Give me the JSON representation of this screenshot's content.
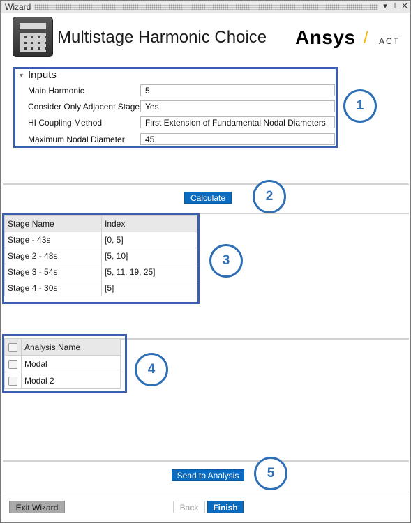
{
  "window": {
    "title": "Wizard",
    "controls": [
      "▾",
      "⊥",
      "✕"
    ]
  },
  "header": {
    "title": "Multistage Harmonic Choice",
    "brand": "Ansys",
    "brand_slash": "/",
    "brand_suffix": "ACT"
  },
  "inputs": {
    "title": "Inputs",
    "fields": [
      {
        "label": "Main Harmonic",
        "value": "5"
      },
      {
        "label": "Consider Only Adjacent Stages",
        "value": "Yes"
      },
      {
        "label": "HI Coupling Method",
        "value": "First Extension of Fundamental Nodal Diameters"
      },
      {
        "label": "Maximum Nodal Diameter",
        "value": "45"
      }
    ]
  },
  "calculate_label": "Calculate",
  "stages": {
    "headers": [
      "Stage Name",
      "Index"
    ],
    "rows": [
      [
        "Stage - 43s",
        "[0, 5]"
      ],
      [
        "Stage 2 - 48s",
        "[5, 10]"
      ],
      [
        "Stage 3 - 54s",
        "[5, 11, 19, 25]"
      ],
      [
        "Stage 4 - 30s",
        "[5]"
      ]
    ]
  },
  "analysis": {
    "header": "Analysis Name",
    "rows": [
      "Modal",
      "Modal 2"
    ]
  },
  "send_label": "Send to Analysis",
  "footer": {
    "exit_label": "Exit Wizard",
    "back_label": "Back",
    "finish_label": "Finish"
  },
  "callouts": [
    "1",
    "2",
    "3",
    "4",
    "5"
  ],
  "colors": {
    "accent_blue": "#0b6bbf",
    "callout_blue": "#2f6fb5",
    "highlight_box": "#3a5fb0",
    "brand_slash": "#f4b400"
  }
}
